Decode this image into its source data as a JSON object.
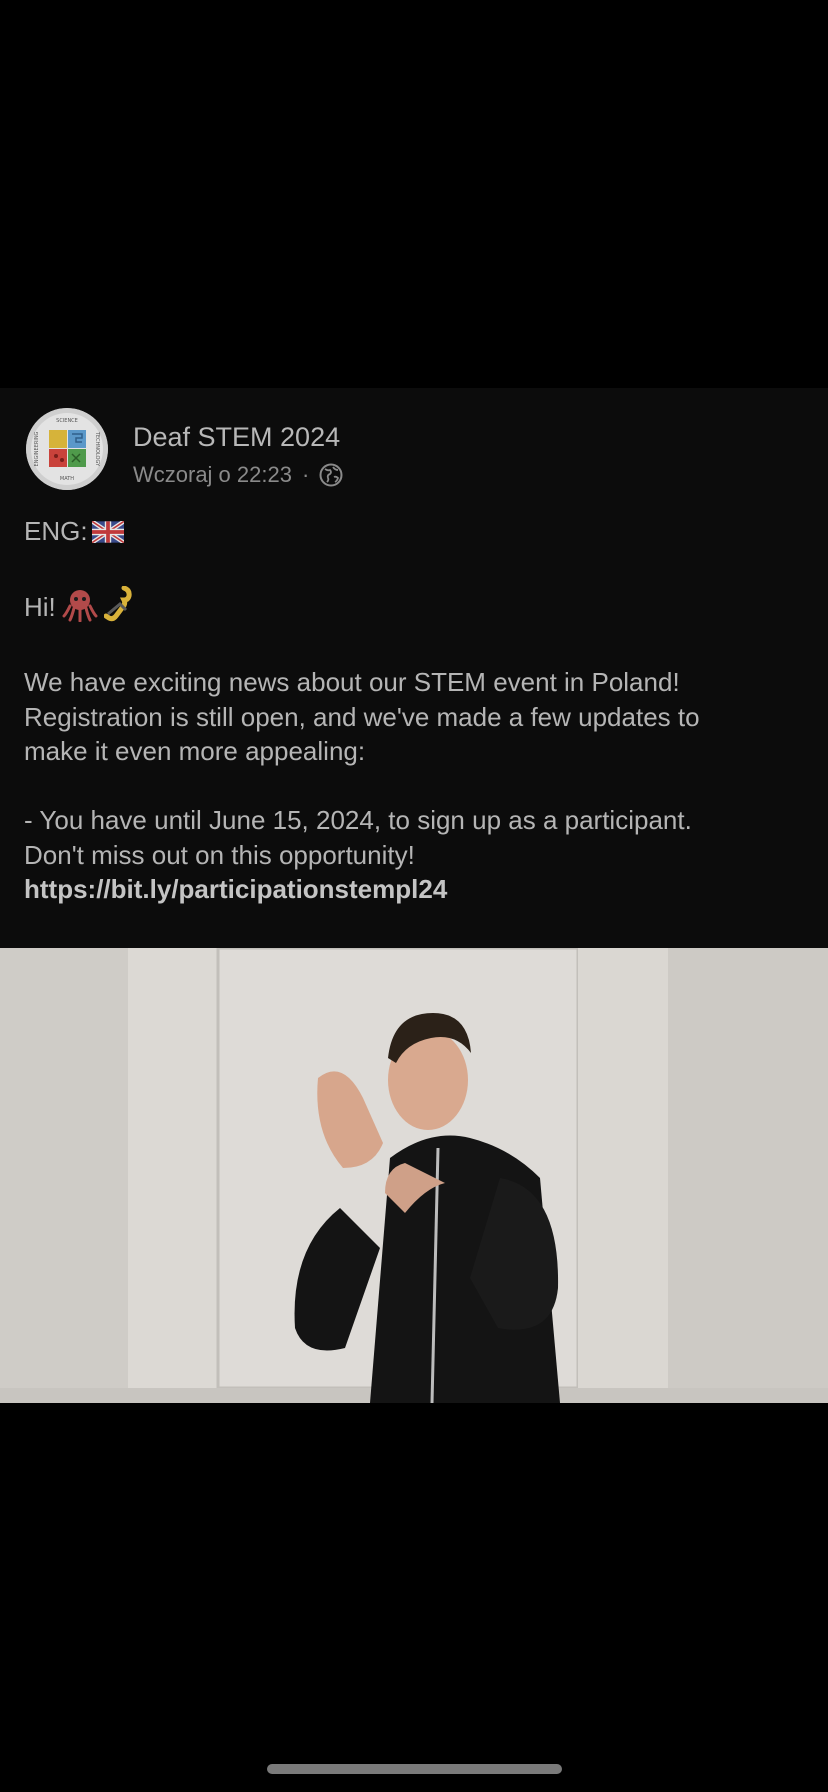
{
  "post": {
    "page_name": "Deaf STEM 2024",
    "timestamp": "Wczoraj o 22:23",
    "separator": "·",
    "privacy_icon": "globe-icon",
    "lines": {
      "eng": "ENG:",
      "hi": "Hi!",
      "p1_l1": "We have exciting news about our STEM event in Poland!",
      "p1_l2": "Registration is still open, and we've made a few updates to",
      "p1_l3": "make it even more appealing:",
      "p2_l1": "- You have until June 15, 2024, to sign up as a participant.",
      "p2_l2": "Don't miss out on this opportunity!"
    },
    "link": "https://bit.ly/participationstempl24"
  },
  "avatar": {
    "logo_words": [
      "SCIENCE",
      "TECHNOLOGY",
      "MATH",
      "ENGINEERING"
    ]
  },
  "colors": {
    "background": "#000000",
    "card": "#0c0c0c",
    "text": "#b5b5b5",
    "meta": "#8a8a8a"
  }
}
